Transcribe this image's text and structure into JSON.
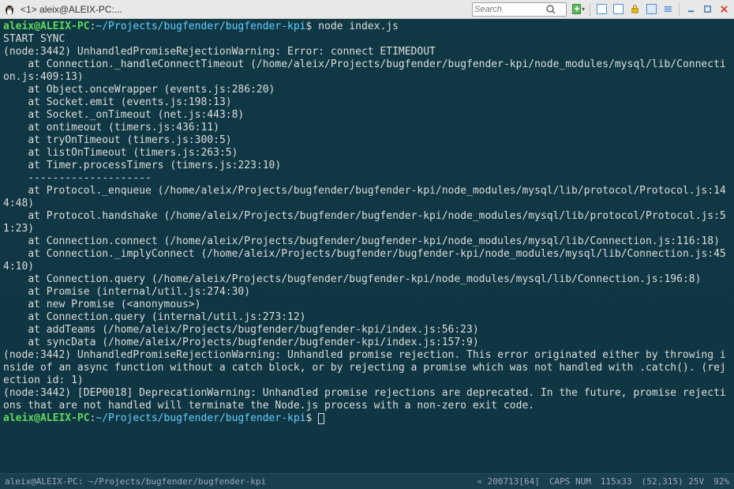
{
  "window": {
    "title": "<1> aleix@ALEIX-PC:..."
  },
  "search": {
    "placeholder": "Search"
  },
  "prompt1": {
    "user": "aleix@ALEIX-PC",
    "sep": ":",
    "path": "~/Projects/bugfender/bugfender-kpi",
    "dollar": "$",
    "cmd": "node index.js"
  },
  "output": {
    "l1": "START SYNC",
    "l2": "(node:3442) UnhandledPromiseRejectionWarning: Error: connect ETIMEDOUT",
    "l3": "    at Connection._handleConnectTimeout (/home/aleix/Projects/bugfender/bugfender-kpi/node_modules/mysql/lib/Connection.js:409:13)",
    "l4": "    at Object.onceWrapper (events.js:286:20)",
    "l5": "    at Socket.emit (events.js:198:13)",
    "l6": "    at Socket._onTimeout (net.js:443:8)",
    "l7": "    at ontimeout (timers.js:436:11)",
    "l8": "    at tryOnTimeout (timers.js:300:5)",
    "l9": "    at listOnTimeout (timers.js:263:5)",
    "l10": "    at Timer.processTimers (timers.js:223:10)",
    "l11": "    --------------------",
    "l12": "    at Protocol._enqueue (/home/aleix/Projects/bugfender/bugfender-kpi/node_modules/mysql/lib/protocol/Protocol.js:144:48)",
    "l13": "    at Protocol.handshake (/home/aleix/Projects/bugfender/bugfender-kpi/node_modules/mysql/lib/protocol/Protocol.js:51:23)",
    "l14": "    at Connection.connect (/home/aleix/Projects/bugfender/bugfender-kpi/node_modules/mysql/lib/Connection.js:116:18)",
    "l15": "    at Connection._implyConnect (/home/aleix/Projects/bugfender/bugfender-kpi/node_modules/mysql/lib/Connection.js:454:10)",
    "l16": "    at Connection.query (/home/aleix/Projects/bugfender/bugfender-kpi/node_modules/mysql/lib/Connection.js:196:8)",
    "l17": "    at Promise (internal/util.js:274:30)",
    "l18": "    at new Promise (<anonymous>)",
    "l19": "    at Connection.query (internal/util.js:273:12)",
    "l20": "    at addTeams (/home/aleix/Projects/bugfender/bugfender-kpi/index.js:56:23)",
    "l21": "    at syncData (/home/aleix/Projects/bugfender/bugfender-kpi/index.js:157:9)",
    "l22": "(node:3442) UnhandledPromiseRejectionWarning: Unhandled promise rejection. This error originated either by throwing inside of an async function without a catch block, or by rejecting a promise which was not handled with .catch(). (rejection id: 1)",
    "l23": "(node:3442) [DEP0018] DeprecationWarning: Unhandled promise rejections are deprecated. In the future, promise rejections that are not handled will terminate the Node.js process with a non-zero exit code."
  },
  "prompt2": {
    "user": "aleix@ALEIX-PC",
    "sep": ":",
    "path": "~/Projects/bugfender/bugfender-kpi",
    "dollar": "$"
  },
  "status": {
    "left": "aleix@ALEIX-PC: ~/Projects/bugfender/bugfender-kpi",
    "enc": "« 200713[64]",
    "caps": "CAPS NUM",
    "size": "115x33",
    "pos": "(52,315) 25V",
    "pct": "92%"
  }
}
